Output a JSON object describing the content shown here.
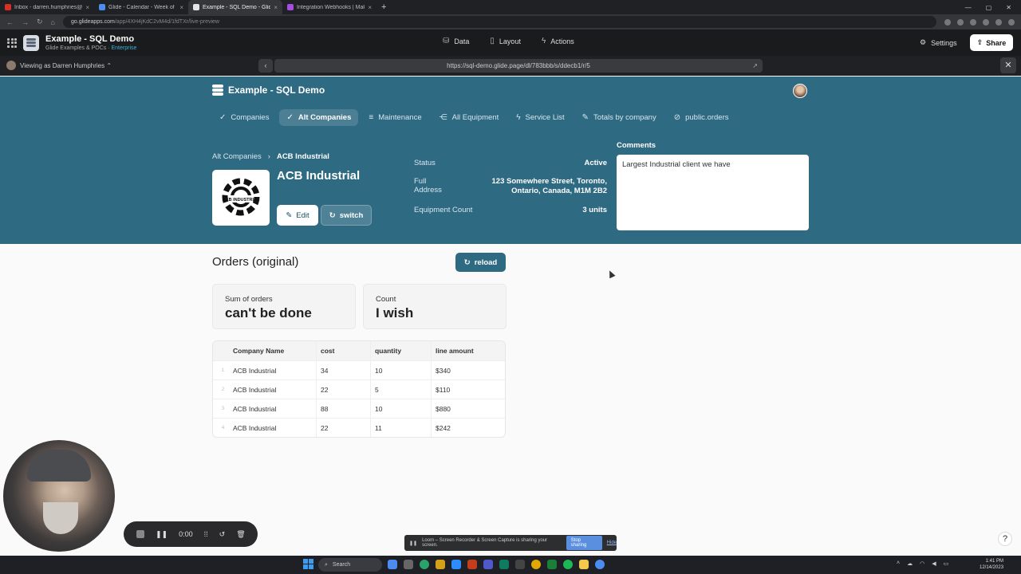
{
  "browser": {
    "tabs": [
      {
        "title": "Inbox - darren.humphries@heyg",
        "active": false,
        "color": "#d93025"
      },
      {
        "title": "Glide - Calendar - Week of Dece",
        "active": false,
        "color": "#4a8cf0"
      },
      {
        "title": "Example - SQL Demo - Glide",
        "active": true,
        "color": "#e5e5e5"
      },
      {
        "title": "Integration Webhooks | Make",
        "active": false,
        "color": "#a64ee0"
      }
    ],
    "url_host": "go.glideapps.com",
    "url_path": "/app/4XH4jKdC2vM4d/1fdTXr/live-preview"
  },
  "builder": {
    "app_name": "Example - SQL Demo",
    "org": "Glide Examples & POCs",
    "plan": "Enterprise",
    "nav": [
      {
        "label": "Data",
        "icon": "database-icon",
        "glyph": "⛁"
      },
      {
        "label": "Layout",
        "icon": "layout-icon",
        "glyph": "▯"
      },
      {
        "label": "Actions",
        "icon": "bolt-icon",
        "glyph": "ϟ"
      }
    ],
    "settings_label": "Settings",
    "share_label": "Share",
    "viewing_as": "Viewing as Darren Humphries ⌃",
    "preview_url": "https://sql-demo.glide.page/dl/783bbb/s/ddecb1/r/5"
  },
  "app": {
    "title": "Example - SQL Demo",
    "tabs": [
      {
        "label": "Companies",
        "icon": "check-circle-icon",
        "glyph": "✓",
        "active": false
      },
      {
        "label": "Alt Companies",
        "icon": "check-circle-icon",
        "glyph": "✓",
        "active": true
      },
      {
        "label": "Maintenance",
        "icon": "list-icon",
        "glyph": "≡",
        "active": false
      },
      {
        "label": "All Equipment",
        "icon": "share-nodes-icon",
        "glyph": "⋲",
        "active": false
      },
      {
        "label": "Service List",
        "icon": "bolt-icon",
        "glyph": "ϟ",
        "active": false
      },
      {
        "label": "Totals by company",
        "icon": "edit-box-icon",
        "glyph": "✎",
        "active": false
      },
      {
        "label": "public.orders",
        "icon": "slash-circle-icon",
        "glyph": "⊘",
        "active": false
      }
    ],
    "breadcrumb": {
      "parent": "Alt Companies",
      "sep": "›",
      "current": "ACB Industrial"
    },
    "company": {
      "name": "ACB Industrial",
      "logo_text": "ACB INDUSTRIAL",
      "edit_label": "Edit",
      "switch_label": "switch"
    },
    "fields": [
      {
        "label": "Status",
        "value": "Active"
      },
      {
        "label": "Full Address",
        "value": "123 Somewhere Street, Toronto, Ontario, Canada, M1M 2B2"
      },
      {
        "label": "Equipment Count",
        "value": "3 units"
      }
    ],
    "comments": {
      "label": "Comments",
      "text": "Largest Industrial client we have"
    },
    "orders": {
      "title": "Orders (original)",
      "reload_label": "reload",
      "stats": [
        {
          "label": "Sum of orders",
          "value": "can't be done"
        },
        {
          "label": "Count",
          "value": "I wish"
        }
      ],
      "columns": [
        "Company Name",
        "cost",
        "quantity",
        "line amount"
      ],
      "rows": [
        {
          "n": "1",
          "company": "ACB Industrial",
          "cost": "34",
          "quantity": "10",
          "amount": "$340"
        },
        {
          "n": "2",
          "company": "ACB Industrial",
          "cost": "22",
          "quantity": "5",
          "amount": "$110"
        },
        {
          "n": "3",
          "company": "ACB Industrial",
          "cost": "88",
          "quantity": "10",
          "amount": "$880"
        },
        {
          "n": "4",
          "company": "ACB Industrial",
          "cost": "22",
          "quantity": "11",
          "amount": "$242"
        }
      ]
    }
  },
  "loom": {
    "timer": "0:00",
    "sharing_text": "Loom – Screen Recorder & Screen Capture is sharing your screen.",
    "stop_label": "Stop sharing",
    "hide_label": "Hide"
  },
  "taskbar": {
    "search_label": "Search",
    "time": "1:41 PM",
    "date": "12/14/2023"
  },
  "colors": {
    "header": "#2f6a83",
    "accent_button": "#2f6a83"
  }
}
